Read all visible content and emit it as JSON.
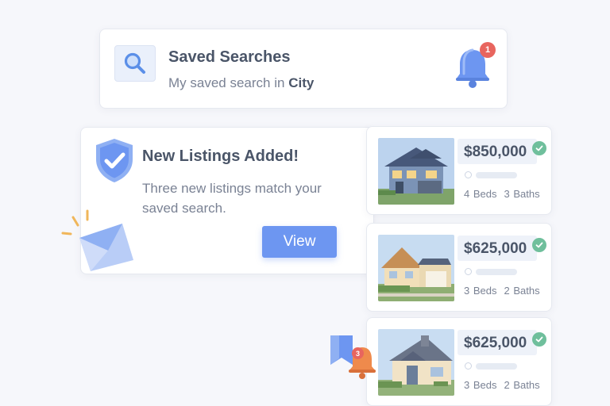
{
  "saved_search": {
    "title": "Saved Searches",
    "subtitle_prefix": "My saved search in ",
    "subtitle_location": "City",
    "icon": "search-icon",
    "notification_icon": "bell-icon",
    "notification_count": "1"
  },
  "notification": {
    "icon": "shield-check-icon",
    "title": "New Listings Added!",
    "body": "Three new listings match your saved search.",
    "button_label": "View"
  },
  "listings": [
    {
      "price": "$850,000",
      "beds": "4 Beds",
      "baths": "3 Baths",
      "verified": true,
      "image": "two-story-house-photo"
    },
    {
      "price": "$625,000",
      "beds": "3 Beds",
      "baths": "2 Baths",
      "verified": true,
      "image": "suburban-house-photo"
    },
    {
      "price": "$625,000",
      "beds": "3 Beds",
      "baths": "2 Baths",
      "verified": true,
      "image": "cottage-house-photo"
    }
  ],
  "floating_alert": {
    "icon": "bell-icon",
    "count": "3"
  },
  "colors": {
    "accent": "#6d96f1",
    "badge": "#e8655e",
    "verified": "#6fbf9c",
    "bell": "#6d96f1",
    "alert_bell": "#ef8a4c"
  }
}
